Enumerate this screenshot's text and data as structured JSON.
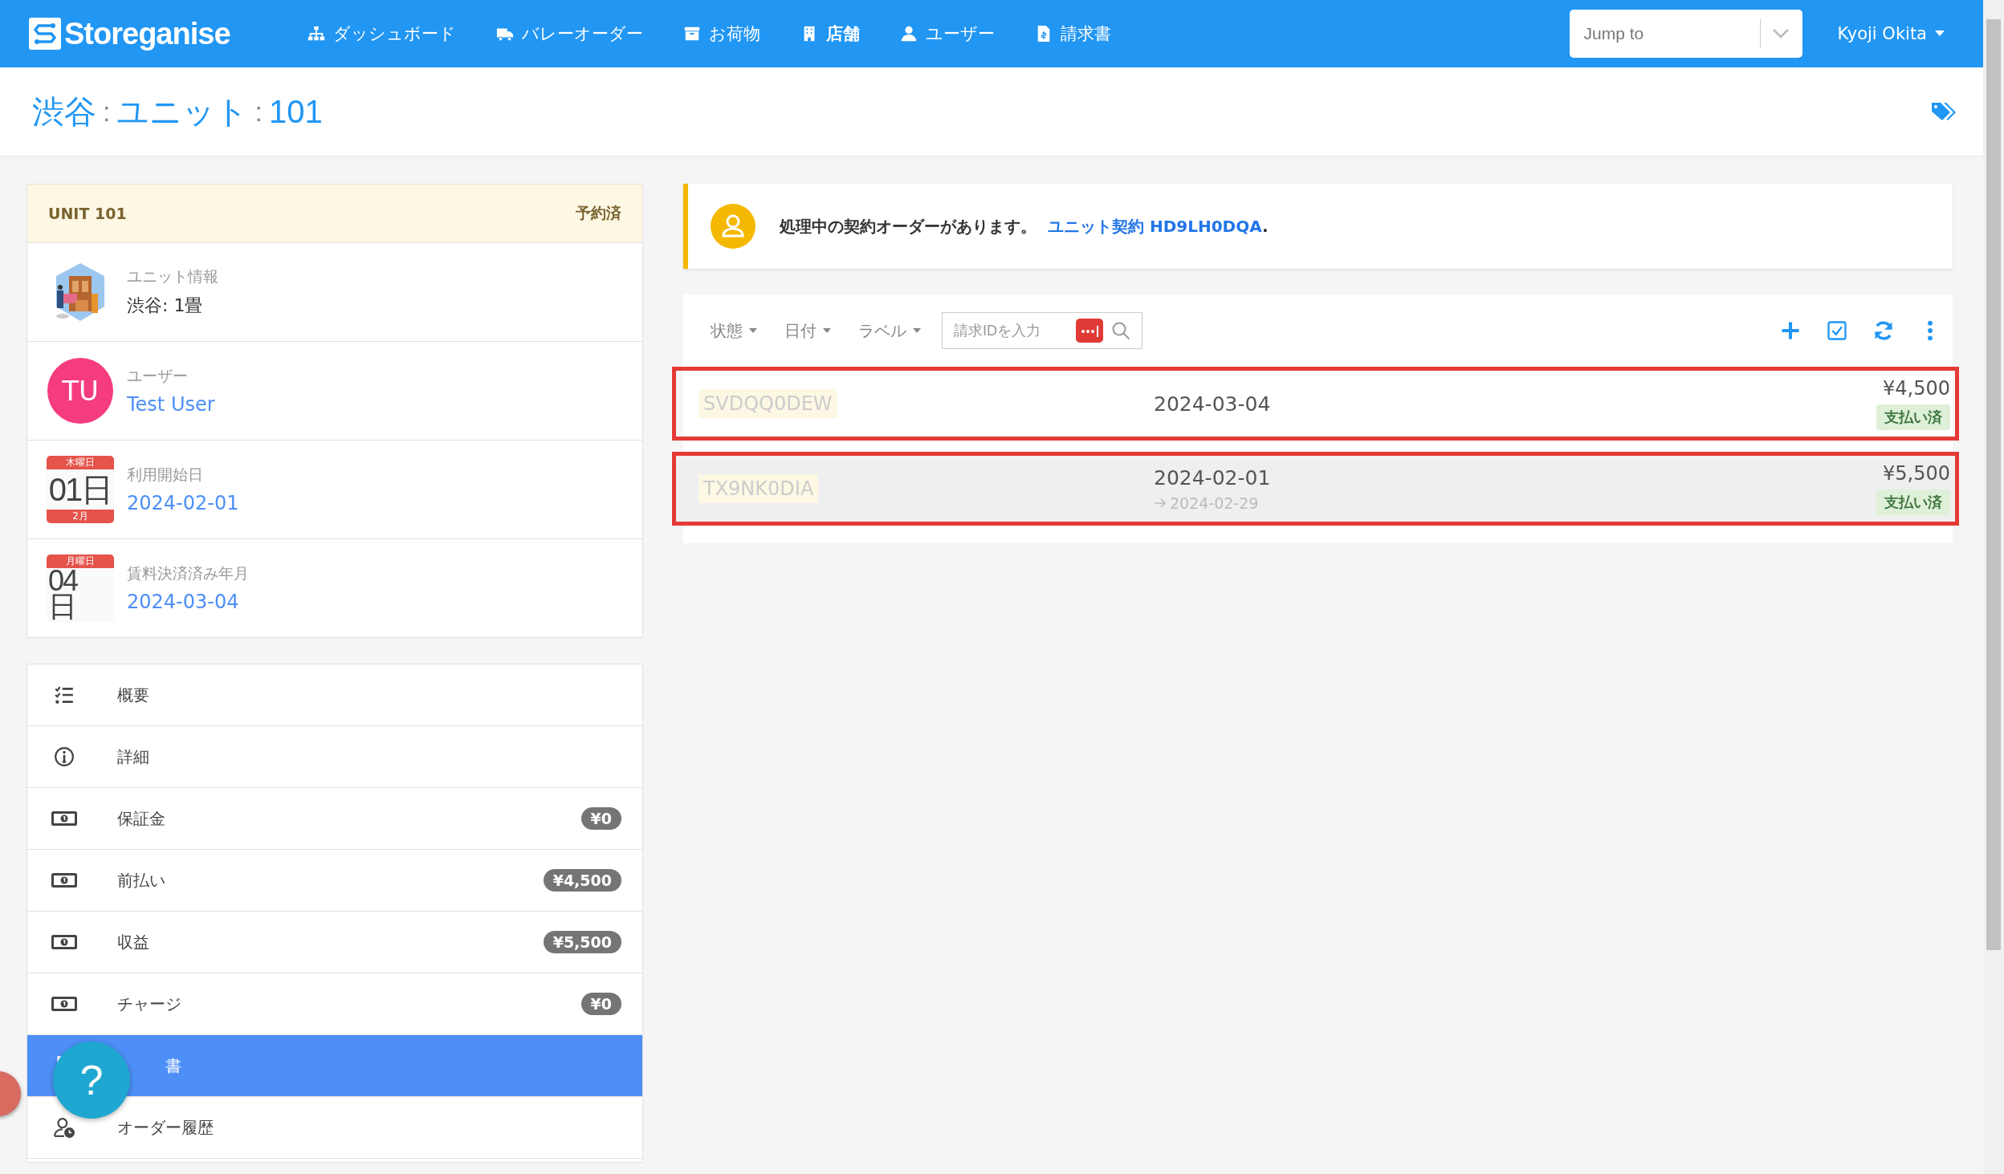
{
  "navbar": {
    "logo": "Storeganise",
    "items": [
      {
        "label": "ダッシュボード",
        "kind": "sitemap",
        "selected": false
      },
      {
        "label": "バレーオーダー",
        "kind": "truck",
        "selected": false
      },
      {
        "label": "お荷物",
        "kind": "archive",
        "selected": false
      },
      {
        "label": "店舗",
        "kind": "building",
        "selected": true
      },
      {
        "label": "ユーザー",
        "kind": "user",
        "selected": false
      },
      {
        "label": "請求書",
        "kind": "file",
        "selected": false
      }
    ],
    "jump_to": {
      "placeholder": "Jump to"
    },
    "user_menu": "Kyoji Okita"
  },
  "breadcrumb": {
    "parts": [
      "渋谷",
      "ユニット",
      "101"
    ],
    "separator": ":"
  },
  "unit_card": {
    "title": "UNIT 101",
    "status": "予約済",
    "rows": [
      {
        "kind": "image",
        "label": "ユニット情報",
        "value": "渋谷: 1畳"
      },
      {
        "kind": "avatar",
        "initials": "TU",
        "label": "ユーザー",
        "value": "Test User"
      },
      {
        "kind": "calendar",
        "weekday": "木曜日",
        "day": "01日",
        "month": "2月",
        "label": "利用開始日",
        "value": "2024-02-01"
      },
      {
        "kind": "calendar",
        "weekday": "月曜日",
        "day": "04日",
        "label": "賃料決済済み年月",
        "value": "2024-03-04"
      }
    ]
  },
  "menu": [
    {
      "label": "概要",
      "kind": "list",
      "selected": false
    },
    {
      "label": "詳細",
      "kind": "info",
      "selected": false
    },
    {
      "label": "保証金",
      "kind": "money",
      "badge": "¥0",
      "selected": false
    },
    {
      "label": "前払い",
      "kind": "money",
      "badge": "¥4,500",
      "selected": false
    },
    {
      "label": "収益",
      "kind": "money",
      "badge": "¥5,500",
      "selected": false
    },
    {
      "label": "チャージ",
      "kind": "money",
      "badge": "¥0",
      "selected": false
    },
    {
      "label": "書",
      "kind": "doc",
      "selected": true
    },
    {
      "label": "オーダー履歴",
      "kind": "user-clock",
      "selected": false
    }
  ],
  "alert": {
    "text": "処理中の契約オーダーがあります。",
    "link": "ユニット契約 HD9LH0DQA",
    "end": "."
  },
  "toolbar": {
    "filters": [
      "状態",
      "日付",
      "ラベル"
    ],
    "search": {
      "placeholder": "請求IDを入力"
    }
  },
  "invoices": [
    {
      "id": "SVDQQ0DEW",
      "date": "2024-03-04",
      "amount": "¥4,500",
      "status": "支払い済",
      "highlighted": true,
      "hovered": false
    },
    {
      "id": "TX9NK0DIA",
      "date": "2024-02-01",
      "end_date": "2024-02-29",
      "amount": "¥5,500",
      "status": "支払い済",
      "highlighted": true,
      "hovered": true
    }
  ],
  "help_button": {
    "label": "?"
  }
}
